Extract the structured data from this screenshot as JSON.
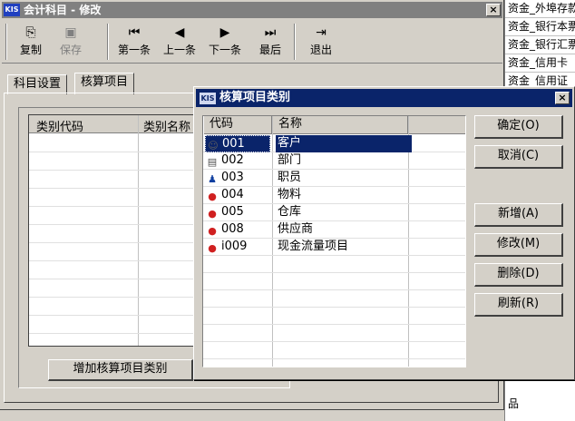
{
  "outer_window": {
    "title": "会计科目 - 修改",
    "logo": "KIS",
    "close": "×"
  },
  "toolbar": {
    "buttons": [
      {
        "label": "复制",
        "icon": "copy-icon",
        "glyph": "⎘",
        "enabled": true
      },
      {
        "label": "保存",
        "icon": "save-icon",
        "glyph": "▣",
        "enabled": false
      },
      {
        "label": "第一条",
        "icon": "first-icon",
        "glyph": "⏮",
        "enabled": true
      },
      {
        "label": "上一条",
        "icon": "prev-icon",
        "glyph": "◀",
        "enabled": true
      },
      {
        "label": "下一条",
        "icon": "next-icon",
        "glyph": "▶",
        "enabled": true
      },
      {
        "label": "最后",
        "icon": "last-icon",
        "glyph": "⏭",
        "enabled": true
      },
      {
        "label": "退出",
        "icon": "exit-icon",
        "glyph": "⇥",
        "enabled": true
      }
    ]
  },
  "tabs": [
    {
      "label": "科目设置",
      "active": false
    },
    {
      "label": "核算项目",
      "active": true
    }
  ],
  "bg_grid": {
    "col1": "类别代码",
    "col2": "类别名称"
  },
  "add_category_label": "增加核算项目类别",
  "right_list": [
    "资金_外埠存款",
    "资金_银行本票",
    "资金_银行汇票",
    "资金_信用卡",
    "资金_信用证"
  ],
  "right_list_bottom": "品",
  "dialog": {
    "title": "核算项目类别",
    "logo": "KIS",
    "close": "×",
    "columns": [
      "代码",
      "名称",
      ""
    ],
    "rows": [
      {
        "code": "001",
        "name": "客户",
        "icon": "customer-icon",
        "glyph": "☺",
        "color": "#606060",
        "selected": true
      },
      {
        "code": "002",
        "name": "部门",
        "icon": "department-icon",
        "glyph": "▤",
        "color": "#505050",
        "selected": false
      },
      {
        "code": "003",
        "name": "职员",
        "icon": "employee-icon",
        "glyph": "♟",
        "color": "#1040a0",
        "selected": false
      },
      {
        "code": "004",
        "name": "物料",
        "icon": "item-icon",
        "glyph": "●",
        "color": "#d02020",
        "selected": false
      },
      {
        "code": "005",
        "name": "仓库",
        "icon": "item-icon",
        "glyph": "●",
        "color": "#d02020",
        "selected": false
      },
      {
        "code": "008",
        "name": "供应商",
        "icon": "item-icon",
        "glyph": "●",
        "color": "#d02020",
        "selected": false
      },
      {
        "code": "i009",
        "name": "现金流量项目",
        "icon": "item-icon",
        "glyph": "●",
        "color": "#d02020",
        "selected": false
      }
    ],
    "buttons": {
      "ok": "确定(O)",
      "cancel": "取消(C)",
      "add": "新增(A)",
      "modify": "修改(M)",
      "delete": "删除(D)",
      "refresh": "刷新(R)"
    }
  }
}
